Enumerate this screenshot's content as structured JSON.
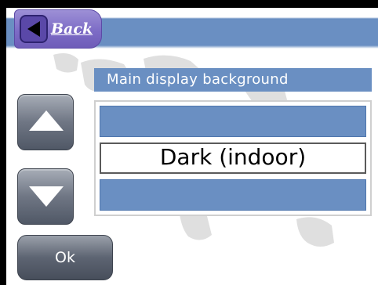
{
  "header": {
    "back_label": "Back"
  },
  "list": {
    "title": "Main display background",
    "selected_value": "Dark (indoor)"
  },
  "buttons": {
    "ok_label": "Ok"
  },
  "colors": {
    "bar_blue": "#6a8fc2",
    "back_purple": "#7d6cc6",
    "button_gray": "#6f7684"
  },
  "icons": {
    "back": "triangle-left-icon",
    "up": "arrow-up-icon",
    "down": "arrow-down-icon"
  }
}
